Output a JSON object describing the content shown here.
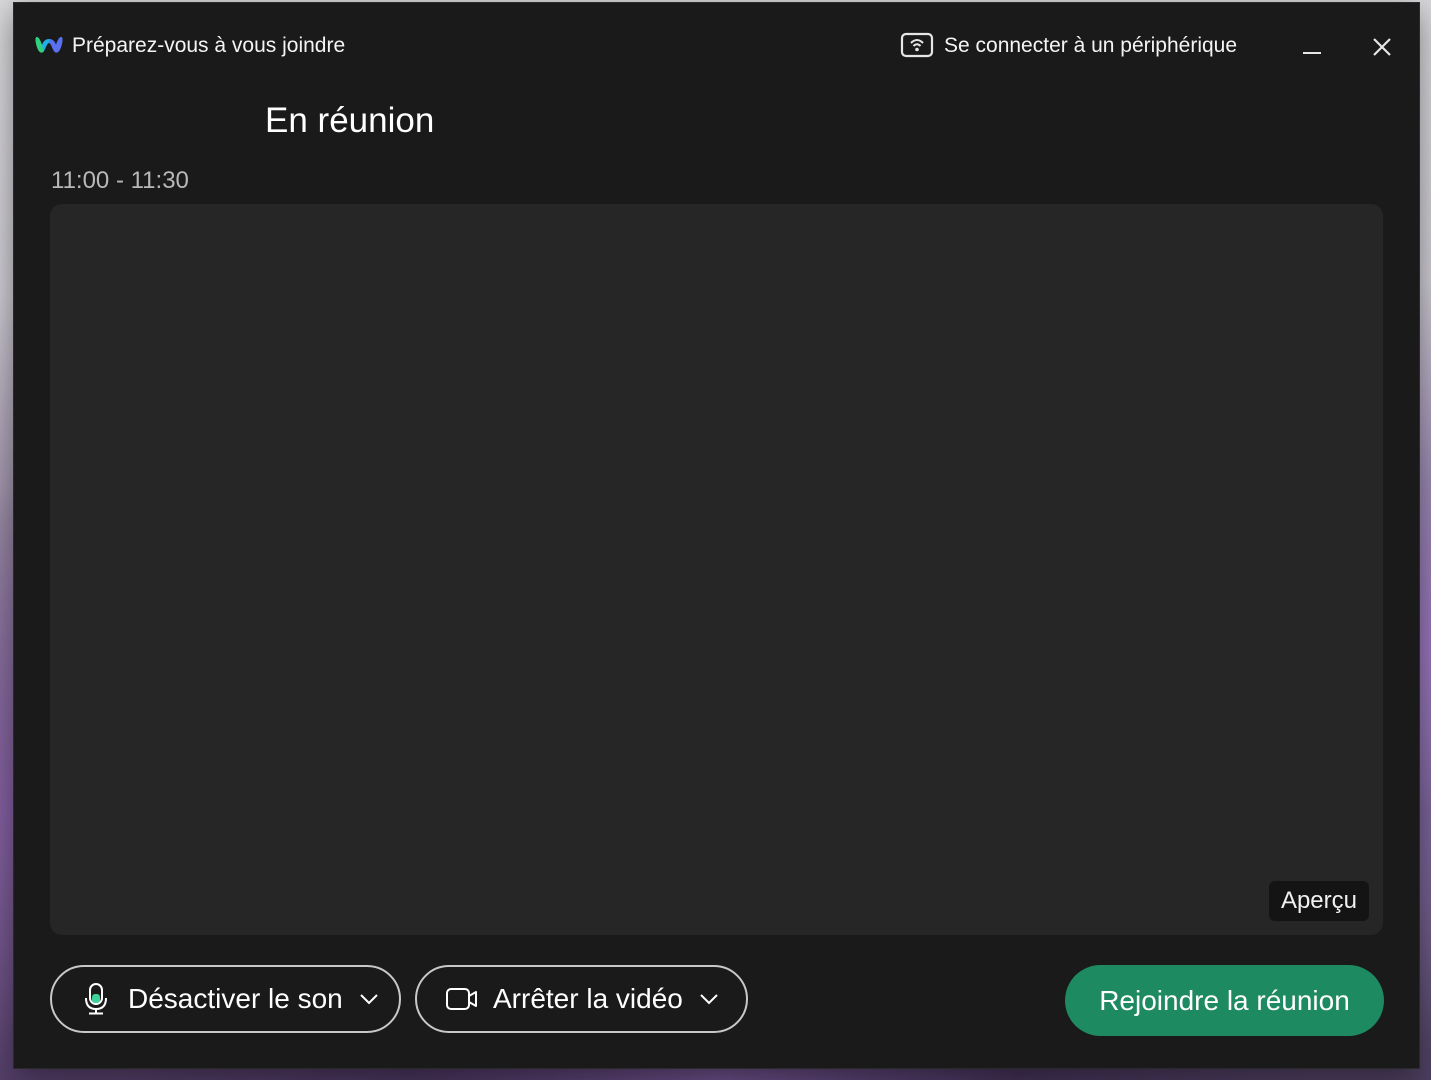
{
  "window": {
    "title": "Préparez-vous à vous joindre",
    "connect_device_label": "Se connecter à un périphérique",
    "icons": {
      "logo": "webex-logo",
      "connect": "cast-screen-icon",
      "minimize": "minimize-icon",
      "close": "close-icon"
    }
  },
  "meeting": {
    "title": "En réunion",
    "time": "11:00 - 11:30"
  },
  "preview": {
    "badge_label": "Aperçu"
  },
  "controls": {
    "mute_label": "Désactiver le son",
    "video_label": "Arrêter la vidéo",
    "join_label": "Rejoindre la réunion",
    "icons": {
      "mute": "microphone-icon",
      "video": "video-camera-icon",
      "dropdown": "chevron-down-icon"
    }
  },
  "colors": {
    "window_bg": "#1a1a1a",
    "preview_bg": "#262626",
    "join_button": "#1d8a62",
    "mic_level": "#3fd39a"
  }
}
